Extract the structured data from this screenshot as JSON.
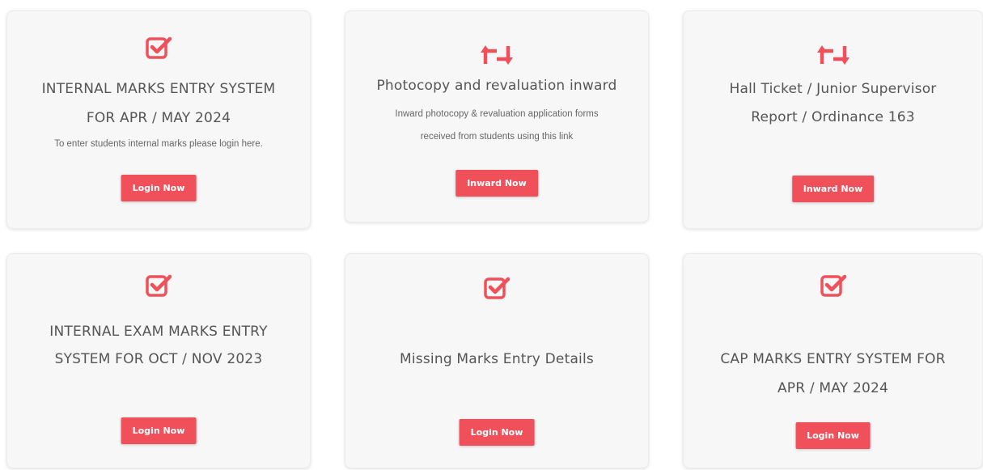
{
  "colors": {
    "accent": "#f0505a",
    "card_bg": "#f7f7f7",
    "title_text": "#555555"
  },
  "cards": [
    {
      "icon": "checkbox-checked-icon",
      "title_lines": [
        "INTERNAL MARKS ENTRY SYSTEM",
        "FOR APR / MAY 2024"
      ],
      "description": "To enter students internal marks please login here.",
      "button_label": "Login Now"
    },
    {
      "icon": "retweet-arrows-icon",
      "title_lines": [
        "Photocopy and revaluation inward"
      ],
      "description_lines": [
        "Inward photocopy & revaluation application forms",
        "received from students using this link"
      ],
      "button_label": "Inward Now"
    },
    {
      "icon": "retweet-arrows-icon",
      "title_lines": [
        "Hall Ticket / Junior Supervisor",
        "Report / Ordinance 163"
      ],
      "button_label": "Inward Now"
    },
    {
      "icon": "checkbox-checked-icon",
      "title_lines": [
        "INTERNAL EXAM MARKS ENTRY",
        "SYSTEM FOR OCT / NOV 2023"
      ],
      "button_label": "Login Now"
    },
    {
      "icon": "checkbox-checked-icon",
      "title_lines": [
        "Missing Marks Entry Details"
      ],
      "button_label": "Login Now"
    },
    {
      "icon": "checkbox-checked-icon",
      "title_lines": [
        "CAP MARKS ENTRY SYSTEM FOR",
        "APR / MAY 2024"
      ],
      "button_label": "Login Now"
    }
  ]
}
